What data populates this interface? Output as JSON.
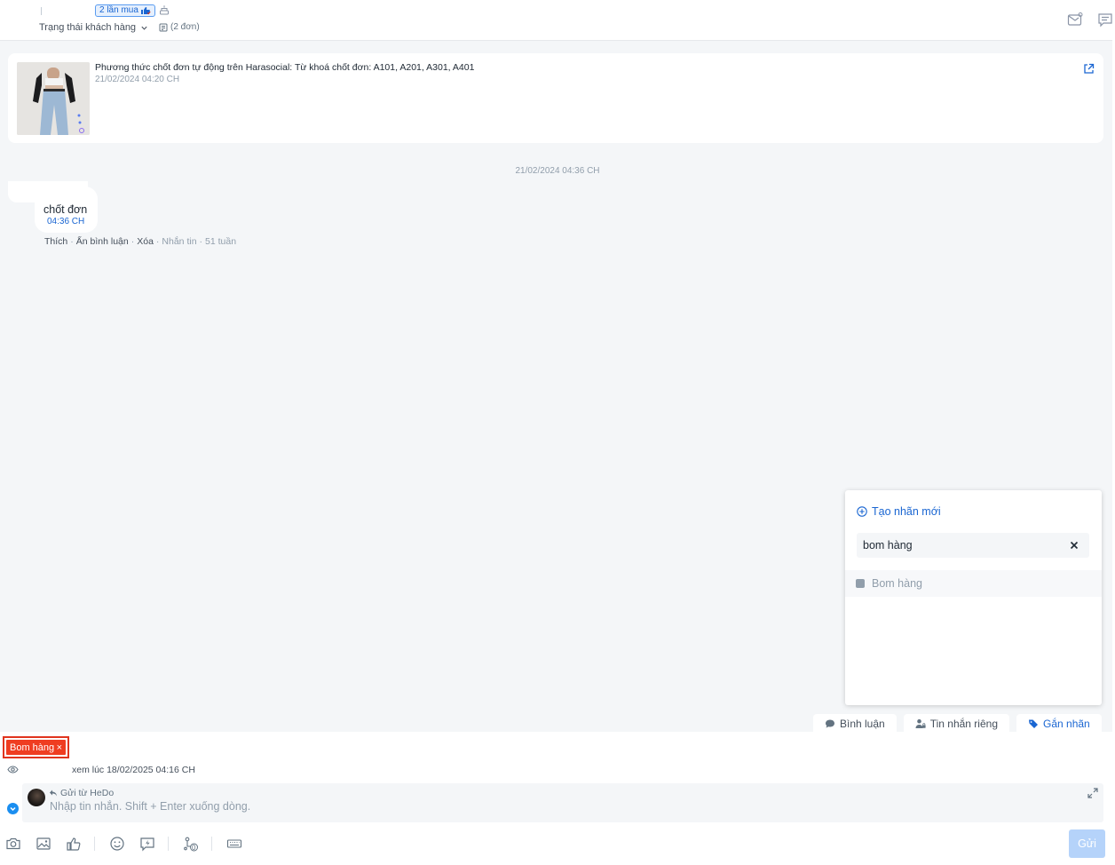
{
  "header": {
    "buy_badge": "2 lần mua",
    "customer_status": "Trạng thái khách hàng",
    "orders_count": "(2 đơn)"
  },
  "post": {
    "title": "Phương thức chốt đơn tự động trên Harasocial: Từ khoá chốt đơn: A101, A201, A301, A401",
    "time": "21/02/2024 04:20 CH"
  },
  "conversation": {
    "date_separator": "21/02/2024 04:36 CH",
    "message": {
      "text": "chốt đơn",
      "time": "04:36 CH",
      "actions": {
        "like": "Thích",
        "hide": "Ẩn bình luận",
        "delete": "Xóa",
        "inbox": "Nhắn tin",
        "ago": "51 tuần"
      }
    }
  },
  "label_panel": {
    "create_label": "Tạo nhãn mới",
    "search_value": "bom hàng",
    "options": [
      {
        "name": "Bom hàng",
        "color": "#919eab"
      }
    ]
  },
  "composer": {
    "tabs": {
      "comment": "Bình luận",
      "private_message": "Tin nhắn riêng",
      "assign_label": "Gắn nhãn"
    },
    "selected_tag": "Bom hàng",
    "seen_text": "xem lúc 18/02/2025 04:16 CH",
    "sent_from": "Gửi từ HeDo",
    "placeholder": "Nhập tin nhắn. Shift + Enter xuống dòng.",
    "send_label": "Gửi",
    "template_count": "0"
  },
  "colors": {
    "accent": "#1a66d2",
    "tag_red": "#ef3d21",
    "send_disabled": "#b5d3fa"
  }
}
